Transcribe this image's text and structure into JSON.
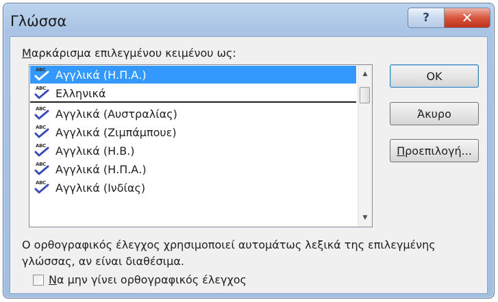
{
  "window": {
    "title": "Γλώσσα",
    "help_glyph": "?",
    "close_glyph": "✕"
  },
  "prompt": {
    "accel": "Μ",
    "rest": "αρκάρισμα επιλεγμένου κειμένου ως:"
  },
  "languages": [
    {
      "label": "Αγγλικά (Η.Π.Α.)",
      "selected": true
    },
    {
      "label": "Ελληνικά",
      "selected": false
    },
    {
      "label": "Αγγλικά (Αυστραλίας)",
      "selected": false
    },
    {
      "label": "Αγγλικά (Ζιμπάμπουε)",
      "selected": false
    },
    {
      "label": "Αγγλικά (Η.Β.)",
      "selected": false
    },
    {
      "label": "Αγγλικά (Η.Π.Α.)",
      "selected": false
    },
    {
      "label": "Αγγλικά (Ινδίας)",
      "selected": false
    }
  ],
  "icons": {
    "spell": "abc-spellcheck-icon",
    "abc_text": "ABC"
  },
  "buttons": {
    "ok": "OK",
    "cancel": "Άκυρο",
    "default_accel": "Π",
    "default_rest": "ροεπιλογή..."
  },
  "scroll": {
    "up": "▲",
    "down": "▼"
  },
  "description": "Ο ορθογραφικός έλεγχος χρησιμοποιεί αυτομάτως λεξικά της επιλεγμένης γλώσσας, αν είναι διαθέσιμα.",
  "checkbox": {
    "accel": "Ν",
    "rest": "α μην γίνει ορθογραφικός έλεγχος",
    "checked": false
  },
  "colors": {
    "selection": "#3399ff",
    "titlebar": "#a9c4e4",
    "close": "#c0331d"
  }
}
